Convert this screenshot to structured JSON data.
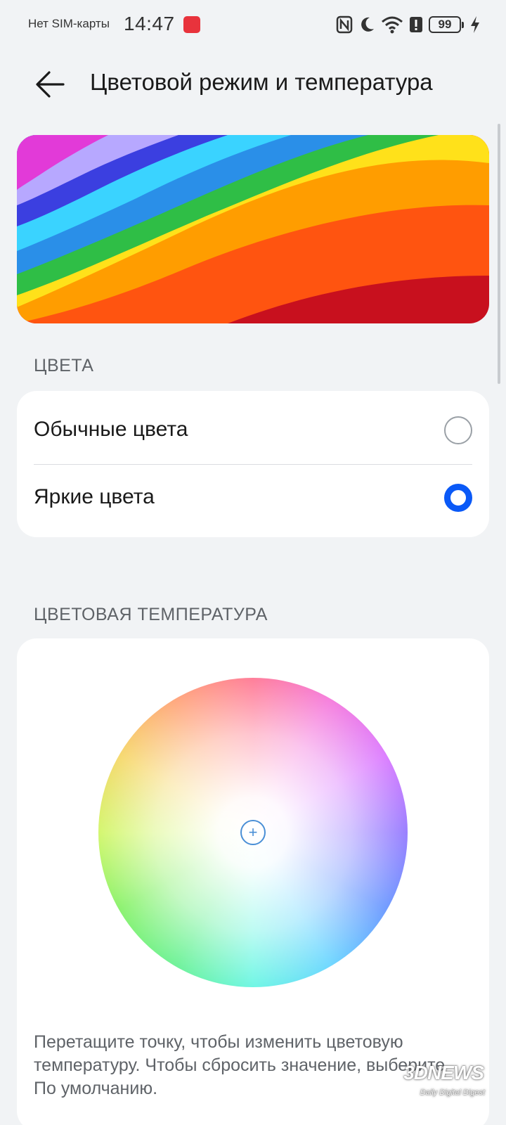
{
  "status_bar": {
    "carrier": "Нет SIM-карты",
    "time": "14:47",
    "battery": "99"
  },
  "header": {
    "title": "Цветовой режим и температура"
  },
  "colors_section": {
    "label": "ЦВЕТА",
    "options": [
      {
        "label": "Обычные цвета",
        "selected": false
      },
      {
        "label": "Яркие цвета",
        "selected": true
      }
    ]
  },
  "temperature_section": {
    "label": "ЦВЕТОВАЯ ТЕМПЕРАТУРА",
    "handle_symbol": "+",
    "hint": "Перетащите точку, чтобы изменить цветовую температуру. Чтобы сбросить значение, выберите По умолчанию."
  },
  "watermark": {
    "main": "3DNEWS",
    "sub": "Daily Digital Digest"
  },
  "colors": {
    "accent": "#0a59f7",
    "background": "#f1f3f5",
    "card": "#ffffff"
  }
}
